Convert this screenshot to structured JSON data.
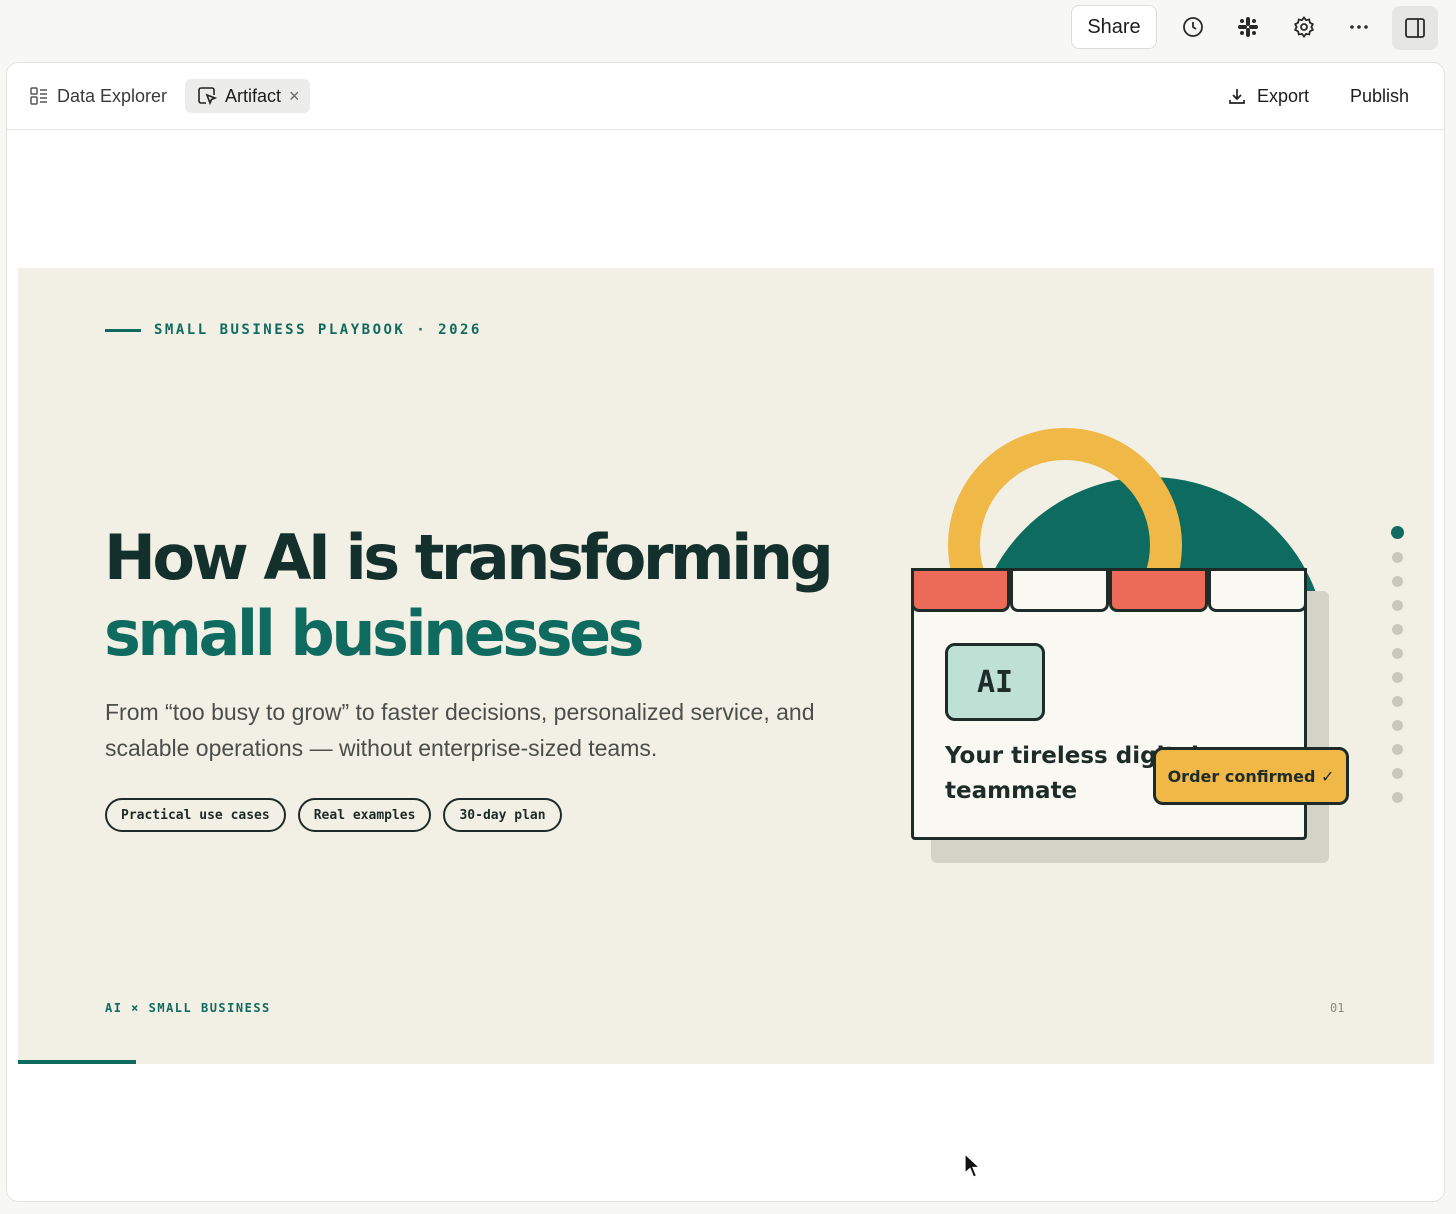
{
  "topbar": {
    "share_label": "Share",
    "icons": [
      "clock-icon",
      "slack-icon",
      "gear-icon",
      "more-icon",
      "panel-toggle-icon"
    ]
  },
  "tabs": [
    {
      "label": "Data Explorer",
      "icon": "grid-list-icon"
    },
    {
      "label": "Artifact",
      "icon": "artifact-icon",
      "close": "×"
    }
  ],
  "actions": {
    "export_label": "Export",
    "publish_label": "Publish"
  },
  "slide": {
    "eyebrow": "SMALL BUSINESS PLAYBOOK · 2026",
    "headline_line1": "How AI is transforming",
    "headline_line2": "small businesses",
    "subtext": "From “too busy to grow” to faster decisions, personalized service, and scalable operations — without enterprise-sized teams.",
    "pills": [
      "Practical use cases",
      "Real examples",
      "30-day plan"
    ],
    "illustration": {
      "badge": "AI",
      "card_text": "Your tireless digital teammate",
      "order_tag": "Order confirmed ✓"
    },
    "footer_left": "AI × SMALL BUSINESS",
    "footer_right": "01",
    "dot_count": 12,
    "active_dot": 1,
    "progress_fraction": 0.083
  },
  "colors": {
    "accent_green": "#0f6b5f",
    "dark_text": "#14302c",
    "slide_bg": "#f2efe4",
    "yellow": "#efb847",
    "red": "#ec6a58",
    "mint": "#bfe0d4"
  }
}
